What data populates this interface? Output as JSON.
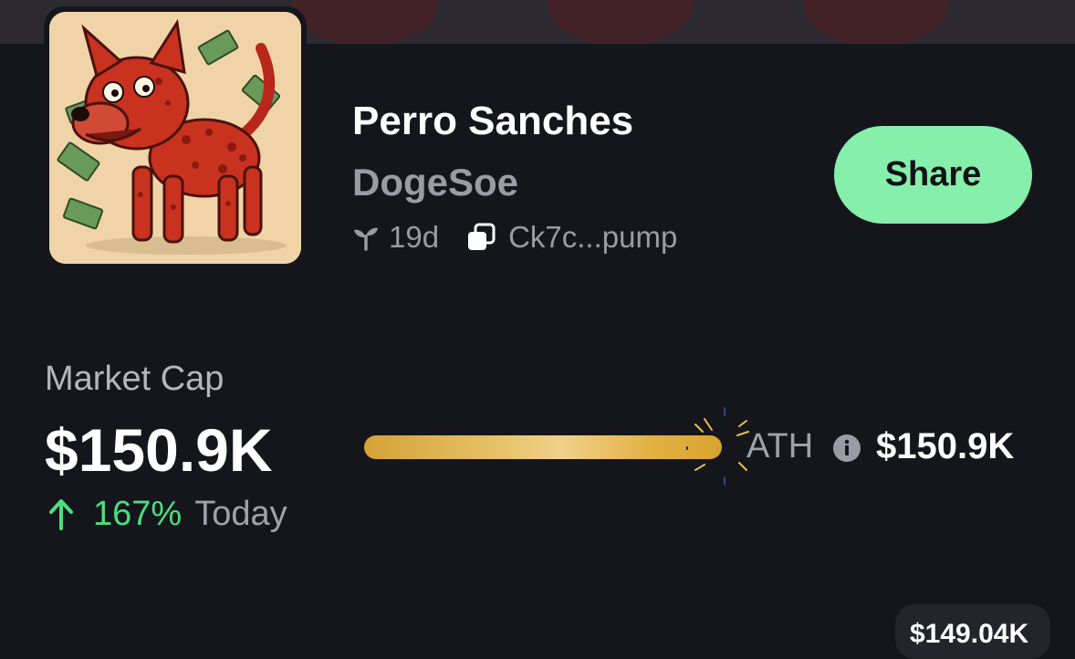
{
  "token": {
    "name": "Perro Sanches",
    "ticker": "DogeSoe",
    "age": "19d",
    "contract": "Ck7c...pump",
    "image_icon": "red-dog-with-money-image"
  },
  "share": {
    "label": "Share"
  },
  "market_cap": {
    "label": "Market Cap",
    "value": "$150.9K",
    "change_percent": "167%",
    "change_period": "Today",
    "change_color": "#4ade80"
  },
  "ath": {
    "label": "ATH",
    "value": "$150.9K",
    "progress": 1.0
  },
  "price_chip": {
    "value": "$149.04K"
  },
  "colors": {
    "background": "#15161b",
    "accent_green": "#86efac",
    "muted_text": "#9a9ba4",
    "gold": "#e2b144"
  },
  "icons": [
    "sprout-icon",
    "copy-icon",
    "arrow-up-icon",
    "info-icon",
    "sparkle-icon"
  ]
}
